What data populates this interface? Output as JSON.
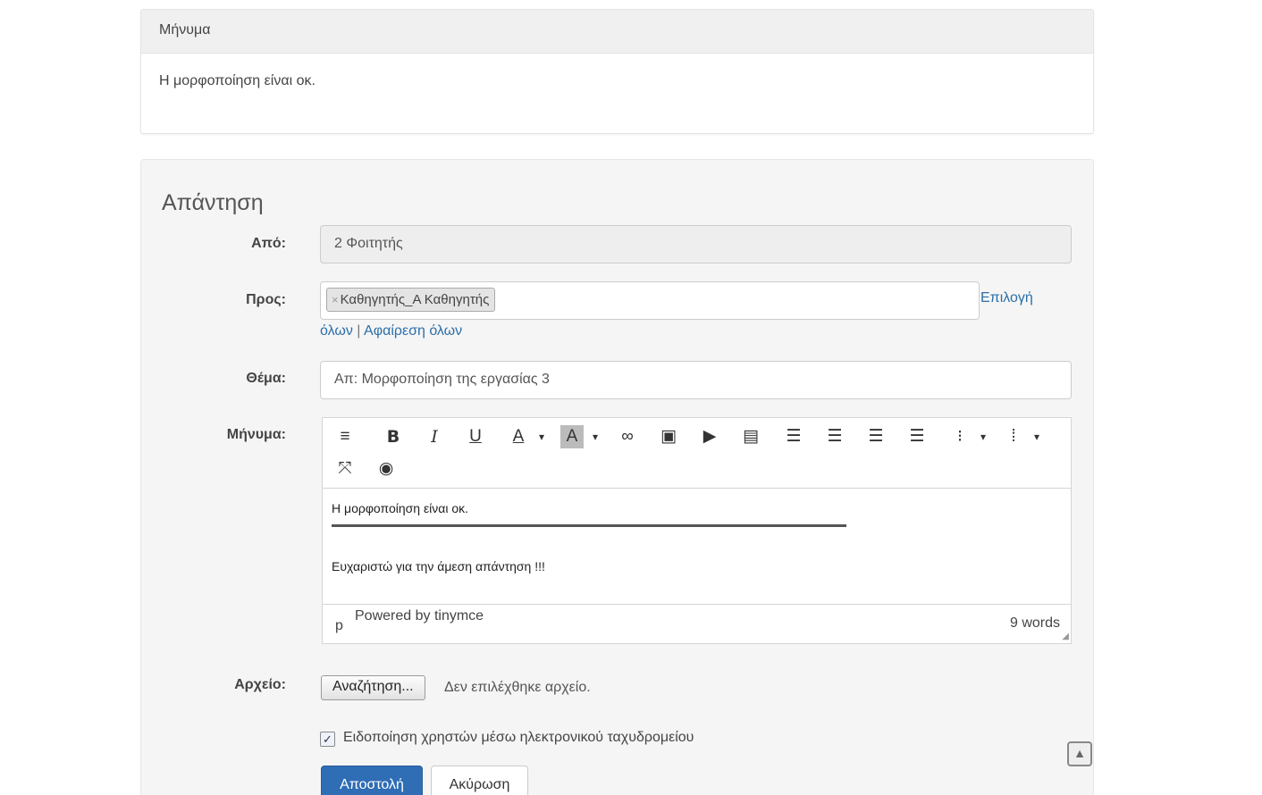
{
  "message_panel": {
    "heading": "Μήνυμα",
    "body": "Η μορφοποίηση είναι οκ."
  },
  "reply": {
    "legend": "Απάντηση",
    "from_label": "Από:",
    "from_value": "2 Φοιτητής",
    "to_label": "Προς:",
    "to_token": "Καθηγητής_Α Καθηγητής",
    "select_all_part1": "Επιλογή",
    "select_all_part2": "όλων",
    "separator": "|",
    "remove_all": "Αφαίρεση όλων",
    "subject_label": "Θέμα:",
    "subject_value": "Απ: Μορφοποίηση της εργασίας 3",
    "message_label": "Μήνυμα:",
    "editor": {
      "toolbar_icons": [
        "format-icon",
        "bold-icon",
        "italic-icon",
        "underline-icon",
        "text-color-icon",
        "bg-color-icon",
        "link-icon",
        "image-icon",
        "media-icon",
        "page-break-icon",
        "align-left-icon",
        "align-center-icon",
        "align-right-icon",
        "align-justify-icon",
        "bullet-list-icon",
        "numbered-list-icon",
        "fullscreen-icon",
        "preview-icon"
      ],
      "line1": "Η μορφοποίηση είναι οκ.",
      "line2": "Ευχαριστώ για την άμεση απάντηση !!!",
      "status_path": "p",
      "powered_by": "Powered by tinymce",
      "word_count": "9 words"
    },
    "file_label": "Αρχείο:",
    "file_button": "Αναζήτηση...",
    "file_status": "Δεν επιλέχθηκε αρχείο.",
    "notify_label": "Ειδοποίηση χρηστών μέσω ηλεκτρονικού ταχυδρομείου",
    "notify_checked": true,
    "submit_label": "Αποστολή",
    "cancel_label": "Ακύρωση"
  },
  "colors": {
    "primary": "#2f6db5",
    "link": "#2a6fa8",
    "well": "#f5f5f5"
  }
}
